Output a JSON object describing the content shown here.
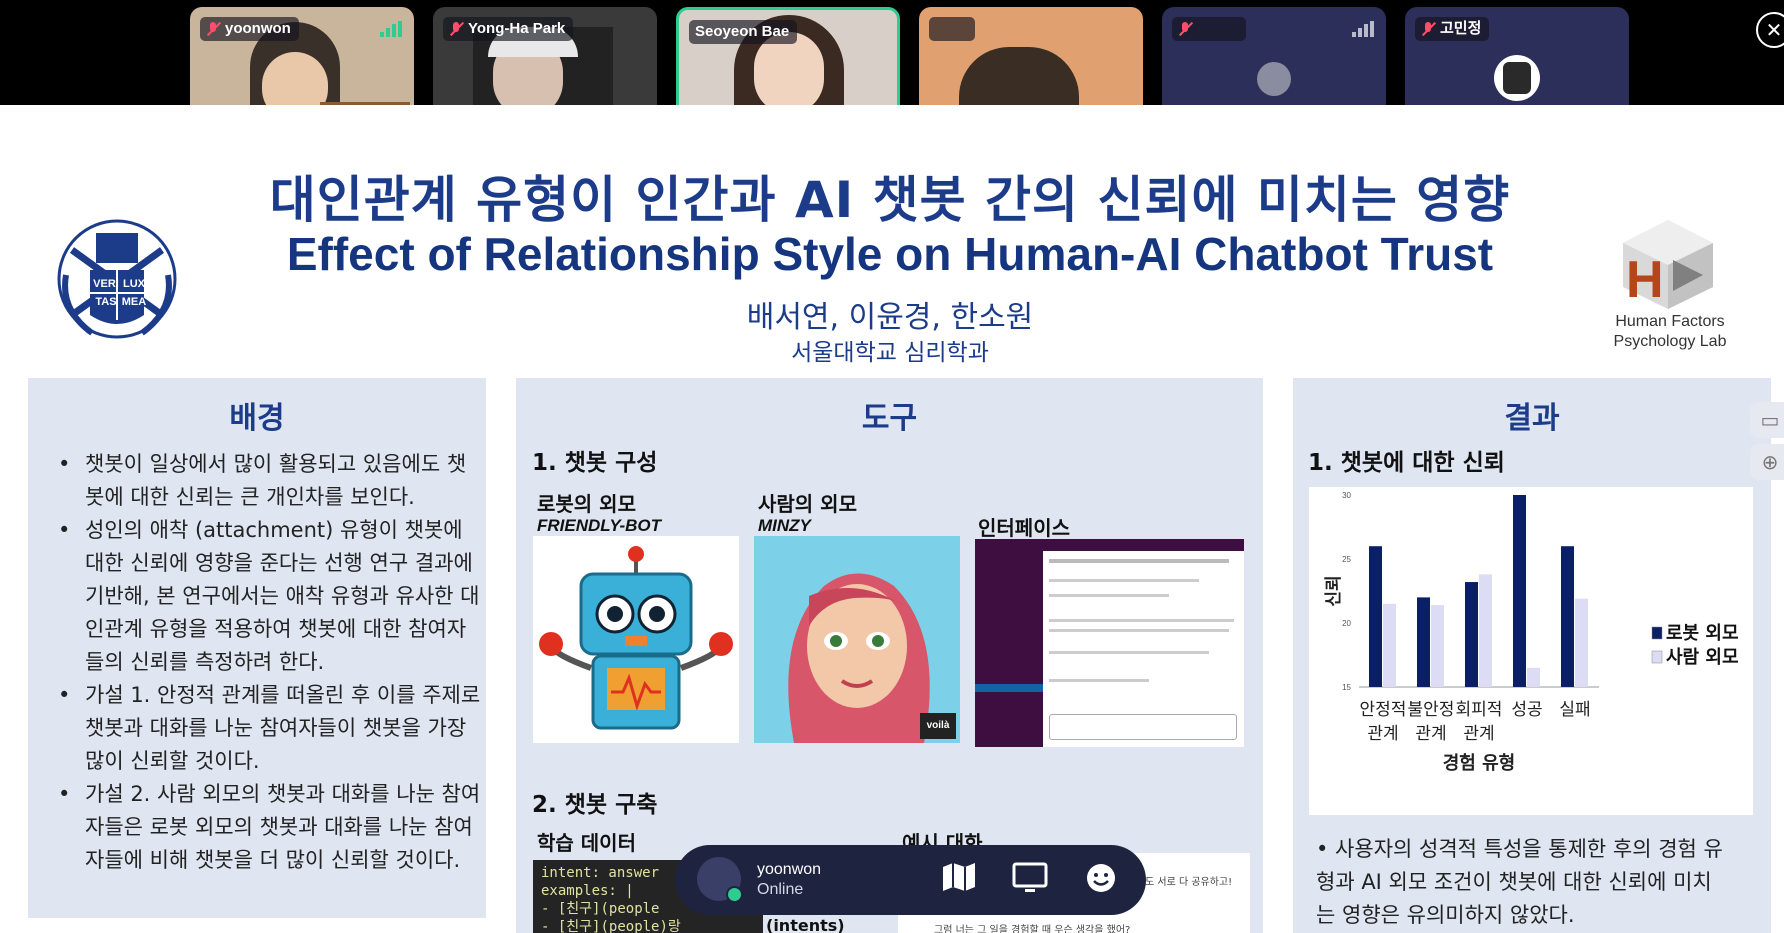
{
  "participants": [
    {
      "name": "yoonwon",
      "muted": true,
      "signal": "green"
    },
    {
      "name": "Yong-Ha Park",
      "muted": true
    },
    {
      "name": "Seoyeon Bae",
      "muted": false,
      "active": true
    },
    {
      "name": "",
      "muted": false
    },
    {
      "name": "",
      "muted": true,
      "signal": "grey"
    },
    {
      "name": "고민정",
      "muted": true
    }
  ],
  "poster": {
    "title_ko": "대인관계 유형이 인간과 AI 챗봇 간의 신뢰에 미치는 영향",
    "title_en": "Effect of Relationship Style on Human-AI Chatbot Trust",
    "authors": "배서연, 이윤경, 한소원",
    "affiliation": "서울대학교 심리학과",
    "lab_name": "Human Factors Psychology Lab",
    "snu_motto": [
      "VERI",
      "LUX",
      "TAS",
      "MEA"
    ],
    "background": {
      "heading": "배경",
      "items": [
        "챗봇이 일상에서 많이 활용되고 있음에도 챗봇에 대한 신뢰는 큰 개인차를 보인다.",
        "성인의 애착 (attachment) 유형이 챗봇에 대한 신뢰에 영향을 준다는 선행 연구 결과에 기반해, 본 연구에서는 애착 유형과 유사한 대인관계 유형을 적용하여 챗봇에 대한 참여자들의 신뢰를 측정하려 한다.",
        "가설 1. 안정적 관계를 떠올린 후 이를 주제로 챗봇과 대화를 나눈 참여자들이 챗봇을 가장 많이 신뢰할 것이다.",
        "가설 2. 사람 외모의 챗봇과 대화를 나눈 참여자들은 로봇 외모의 챗봇과 대화를 나눈 참여자들에 비해 챗봇을 더 많이 신뢰할 것이다."
      ]
    },
    "tools": {
      "heading": "도구",
      "section1": "1. 챗봇 구성",
      "robot_label": "로봇의 외모",
      "robot_name": "FRIENDLY-BOT",
      "human_label": "사람의 외모",
      "human_name": "MINZY",
      "interface_label": "인터페이스",
      "voila": "voilà",
      "section2": "2. 챗봇 구축",
      "training_label": "학습 데이터",
      "example_label": "예시 대화",
      "code_lines": [
        "intent: answer",
        "examples: |",
        "  - [친구](people",
        "  - [친구](people)랑"
      ],
      "intents_label": "(intents)",
      "convo_snippet_1": "도 서로 다 공유하고!",
      "convo_snippet_2": "그럼 너는 그 일을 경험할 때 우슨 생각을 했어?"
    },
    "results": {
      "heading": "결과",
      "section1": "1. 챗봇에 대한 신뢰",
      "text": "• 사용자의 성격적 특성을 통제한 후의 경험 유형과 AI 외모 조건이 챗봇에 대한 신뢰에 미치는 영향은 유의미하지 않았다."
    }
  },
  "chart_data": {
    "type": "bar",
    "categories": [
      "안정적 관계",
      "불안정 관계",
      "회피적 관계",
      "성공",
      "실패"
    ],
    "category_lines": [
      [
        "안정적",
        "관계"
      ],
      [
        "불안정",
        "관계"
      ],
      [
        "회피적",
        "관계"
      ],
      [
        "성공"
      ],
      [
        "실패"
      ]
    ],
    "series": [
      {
        "name": "로봇 외모",
        "values": [
          26,
          22,
          23.2,
          30,
          26
        ],
        "color": "#0b1f66"
      },
      {
        "name": "사람 외모",
        "values": [
          21.5,
          21.4,
          23.8,
          16.5,
          21.9
        ],
        "color": "#dcdcf4"
      }
    ],
    "ylim": [
      15,
      30
    ],
    "yticks": [
      15,
      20,
      25,
      30
    ],
    "ylabel": "신뢰",
    "xlabel": "경험 유형",
    "legend_position": "right"
  },
  "control_bar": {
    "user": "yoonwon",
    "status": "Online",
    "buttons": [
      "map-icon",
      "screen-share-icon",
      "emoji-icon"
    ]
  }
}
